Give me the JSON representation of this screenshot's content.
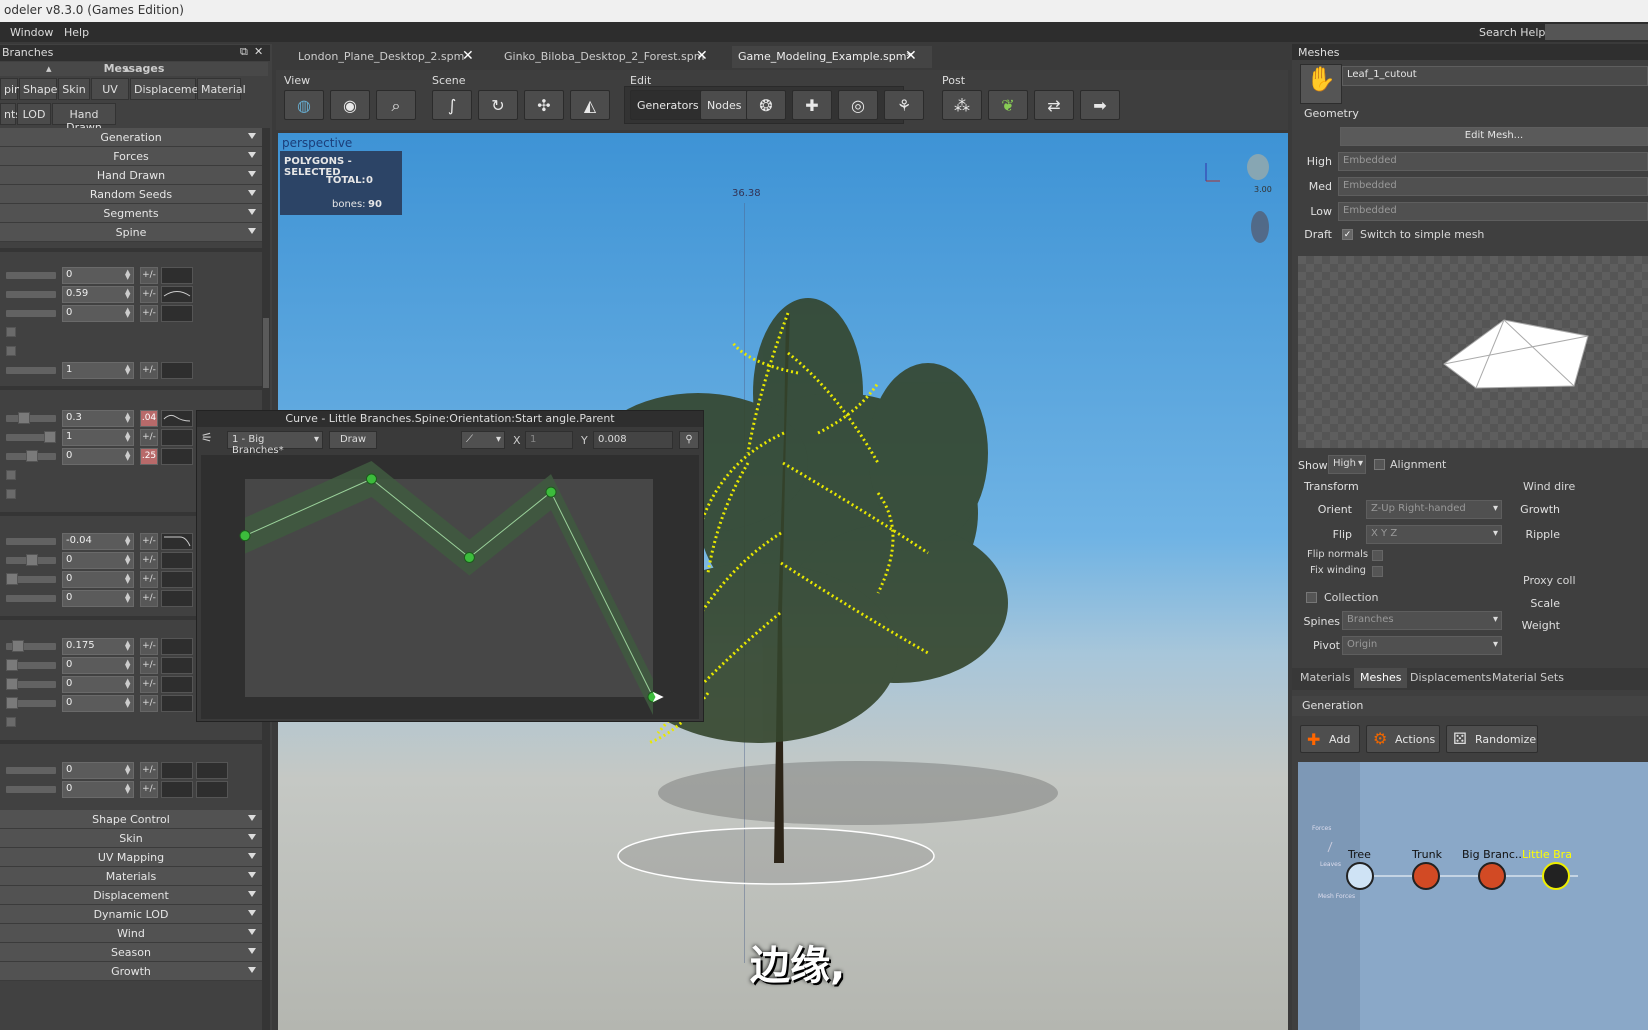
{
  "window": {
    "title": "odeler v8.3.0 (Games Edition)",
    "menu": [
      "Window",
      "Help"
    ],
    "search_help_label": "Search Help:"
  },
  "left_panel": {
    "title": "Branches",
    "messages_label": "Messages",
    "tabs_row1": [
      "pine",
      "Shape",
      "Skin",
      "UV",
      "Displacement",
      "Material"
    ],
    "tabs_row2": [
      "nts",
      "LOD",
      "Hand Drawn"
    ],
    "rollouts_top": [
      "Generation",
      "Forces",
      "Hand Drawn",
      "Random Seeds",
      "Segments",
      "Spine"
    ],
    "params_group1": [
      "0",
      "0.59",
      "0"
    ],
    "params_group1b": [
      "1"
    ],
    "params_group2": [
      "0.3",
      "1",
      "0"
    ],
    "params_group2_badges": [
      ".04",
      "",
      ".25"
    ],
    "params_group3": [
      "-0.04",
      "0",
      "0",
      "0"
    ],
    "params_group4": [
      "0.175",
      "0",
      "0",
      "0"
    ],
    "params_group5": [
      "0",
      "0"
    ],
    "pm_label": "+/-",
    "rollouts_bottom": [
      "Shape Control",
      "Skin",
      "UV Mapping",
      "Materials",
      "Displacement",
      "Dynamic LOD",
      "Wind",
      "Season",
      "Growth"
    ]
  },
  "doc_tabs": [
    {
      "label": "London_Plane_Desktop_2.spm",
      "active": false
    },
    {
      "label": "Ginko_Biloba_Desktop_2_Forest.spm",
      "active": false
    },
    {
      "label": "Game_Modeling_Example.spm*",
      "active": true
    }
  ],
  "toolbar": {
    "groups": [
      "View",
      "Scene",
      "Edit",
      "Post"
    ],
    "edit_generators": "Generators",
    "edit_nodes": "Nodes"
  },
  "viewport": {
    "label": "perspective",
    "stats_title": "POLYGONS - SELECTED",
    "stats_total_label": "TOTAL:",
    "stats_total": "0",
    "stats_bones_label": "bones:",
    "stats_bones": "90",
    "measure": "36.38",
    "gizmo_value": "3.00",
    "subtitle": "边缘,"
  },
  "curve_window": {
    "title": "Curve - Little Branches.Spine:Orientation:Start angle.Parent",
    "dropdown": "1 - Big Branches*",
    "draw_label": "Draw",
    "x_label": "X",
    "x_value": "1",
    "y_label": "Y",
    "y_value": "0.008",
    "points": [
      [
        0,
        0.74
      ],
      [
        0.31,
        1.0
      ],
      [
        0.55,
        0.64
      ],
      [
        0.75,
        0.94
      ],
      [
        1.0,
        0.0
      ]
    ]
  },
  "right_panel": {
    "meshes_title": "Meshes",
    "mesh_name": "Leaf_1_cutout",
    "geometry_label": "Geometry",
    "edit_mesh": "Edit Mesh...",
    "lod_rows": [
      {
        "label": "High",
        "value": "Embedded"
      },
      {
        "label": "Med",
        "value": "Embedded"
      },
      {
        "label": "Low",
        "value": "Embedded"
      }
    ],
    "draft_label": "Draft",
    "draft_check": "Switch to simple mesh",
    "show_label": "Show",
    "show_value": "High",
    "alignment": "Alignment",
    "transform_label": "Transform",
    "orient_label": "Orient",
    "orient_value": "Z-Up Right-handed",
    "flip_label": "Flip",
    "flip_value": "X Y Z",
    "flip_normals": "Flip normals",
    "fix_winding": "Fix winding",
    "collection": "Collection",
    "spines_label": "Spines",
    "spines_value": "Branches",
    "pivot_label": "Pivot",
    "pivot_value": "Origin",
    "wind_dir": "Wind dire",
    "growth": "Growth",
    "ripple": "Ripple",
    "proxy": "Proxy coll",
    "scale": "Scale",
    "weight": "Weight",
    "bottom_tabs": [
      "Materials",
      "Meshes",
      "Displacements",
      "Material Sets"
    ],
    "generation_label": "Generation",
    "add": "Add",
    "actions": "Actions",
    "randomize": "Randomize",
    "nodes": [
      "Tree",
      "Trunk",
      "Big Branc...",
      "Little Bra"
    ]
  }
}
